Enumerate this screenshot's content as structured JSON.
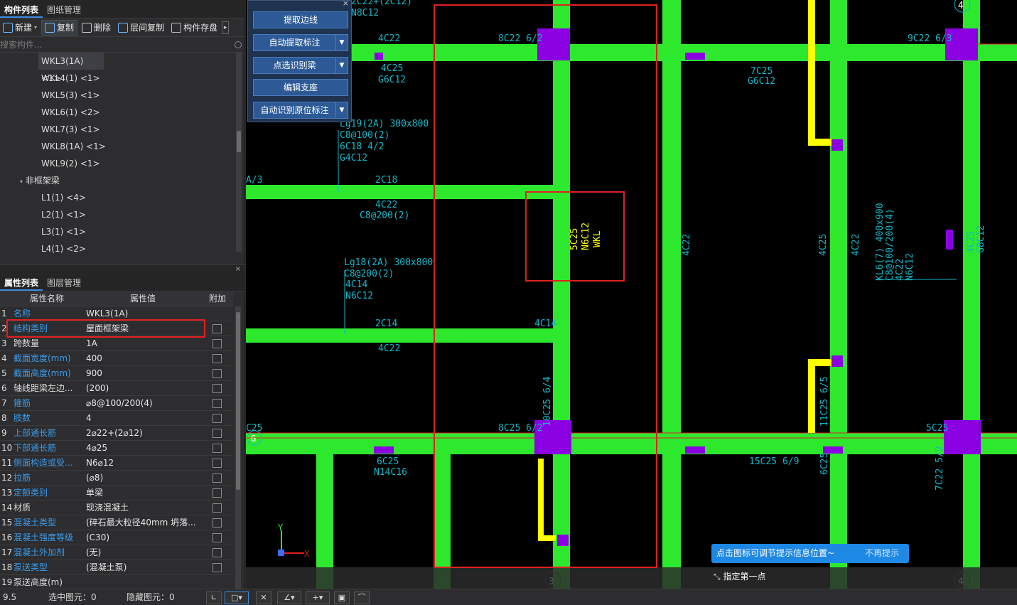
{
  "left_panel": {
    "top_tabs": [
      "构件列表",
      "图纸管理"
    ],
    "toolbar": {
      "new": "新建",
      "copy": "复制",
      "delete": "删除",
      "floor_copy": "层间复制",
      "save_component": "构件存盘"
    },
    "search_placeholder": "搜索构件...",
    "tree_items": [
      "WKL3(1A) <1>",
      "WKL4(1) <1>",
      "WKL5(3) <1>",
      "WKL6(1) <2>",
      "WKL7(3) <1>",
      "WKL8(1A) <1>",
      "WKL9(2) <1>"
    ],
    "tree_group": "非框架梁",
    "tree_items_2": [
      "L1(1) <4>",
      "L2(1) <1>",
      "L3(1) <1>",
      "L4(1) <2>"
    ],
    "bottom_tabs": [
      "属性列表",
      "图层管理"
    ],
    "prop_headers": [
      "属性名称",
      "属性值",
      "附加"
    ],
    "properties": [
      {
        "n": "1",
        "k": "名称",
        "v": "WKL3(1A)"
      },
      {
        "n": "2",
        "k": "结构类别",
        "v": "屋面框架梁"
      },
      {
        "n": "3",
        "k": "跨数量",
        "v": "1A"
      },
      {
        "n": "4",
        "k": "截面宽度(mm)",
        "v": "400"
      },
      {
        "n": "5",
        "k": "截面高度(mm)",
        "v": "900"
      },
      {
        "n": "6",
        "k": "轴线距梁左边...",
        "v": "(200)"
      },
      {
        "n": "7",
        "k": "箍筋",
        "v": "⌀8@100/200(4)"
      },
      {
        "n": "8",
        "k": "肢数",
        "v": "4"
      },
      {
        "n": "9",
        "k": "上部通长筋",
        "v": "2⌀22+(2⌀12)"
      },
      {
        "n": "10",
        "k": "下部通长筋",
        "v": "4⌀25"
      },
      {
        "n": "11",
        "k": "侧面构造或受...",
        "v": "N6⌀12"
      },
      {
        "n": "12",
        "k": "拉筋",
        "v": "(⌀8)"
      },
      {
        "n": "13",
        "k": "定额类别",
        "v": "单梁"
      },
      {
        "n": "14",
        "k": "材质",
        "v": "现浇混凝土"
      },
      {
        "n": "15",
        "k": "混凝土类型",
        "v": "(碎石最大粒径40mm 坍落..."
      },
      {
        "n": "16",
        "k": "混凝土强度等级",
        "v": "(C30)"
      },
      {
        "n": "17",
        "k": "混凝土外加剂",
        "v": "(无)"
      },
      {
        "n": "18",
        "k": "泵送类型",
        "v": "(混凝土泵)"
      },
      {
        "n": "19",
        "k": "泵送高度(m)",
        "v": ""
      }
    ]
  },
  "command_panel": {
    "buttons": [
      "提取边线",
      "自动提取标注",
      "点选识别梁",
      "编辑支座",
      "自动识别原位标注"
    ]
  },
  "canvas": {
    "labels": {
      "top_c22": "2C22+(2C12)",
      "n8c12": "N8C12",
      "c4_22": "4C22",
      "c8_22": "8C22 6/2",
      "c4_25": "4C25",
      "g6c12": "G6C12",
      "lg19": "Lg19(2A) 300x800",
      "c8_100": "C8@100(2)",
      "c6_18": "6C18 4/2",
      "g4c12": "G4C12",
      "a3": "A/3",
      "c2_18": "2C18",
      "c4_22b": "4C22",
      "c8_200": "C8@200(2)",
      "lg18": "Lg18(2A) 300x800",
      "c8_200b": "C8@200(2)",
      "c4_14": "4C14",
      "n6c12": "N6C12",
      "c2_14": "2C14",
      "c4_14b": "4C14",
      "c4_22c": "4C22",
      "v5c25": "5C25",
      "vn6c12": "N6C12",
      "vwkl": "WKL",
      "c7_25": "7C25",
      "g6c12b": "G6C12",
      "c9_22": "9C22 6/3",
      "c10_25": "10C25 6/4",
      "c8_25": "8C25 6/2",
      "c6_25": "6C25",
      "n14c16": "N14C16",
      "c15_25": "15C25 6/9",
      "c5_25": "5C25",
      "c11_25": "11C25 6/5",
      "kl6": "KL6(7) 400x900",
      "kl6b": "C8@100/200(4)",
      "kl6c": "4C22",
      "kl6d": "N6C12",
      "c4_25r": "4C25",
      "g8c12": "G8C12",
      "c7_22": "7C22 5/2",
      "c4_22v": "4C22",
      "c4_25v": "4C25",
      "axis_g": "G",
      "axis_3": "3",
      "axis_4": "4",
      "axis_4b": "4",
      "axis_3b": "3",
      "c25": "C25"
    },
    "axis_y": "Y",
    "axis_x": "X"
  },
  "tooltip": {
    "text": "点击图标可调节提示信息位置~",
    "dismiss": "不再提示"
  },
  "prompt": "指定第一点",
  "status": {
    "zoom": "9.5",
    "selected": "选中图元：0",
    "hidden": "隐藏图元：0"
  },
  "colors": {
    "beam": "#2ee82e",
    "column": "#8a00e0",
    "label": "#10b8c8",
    "highlight": "#ffff00",
    "annotation": "#e02020"
  }
}
